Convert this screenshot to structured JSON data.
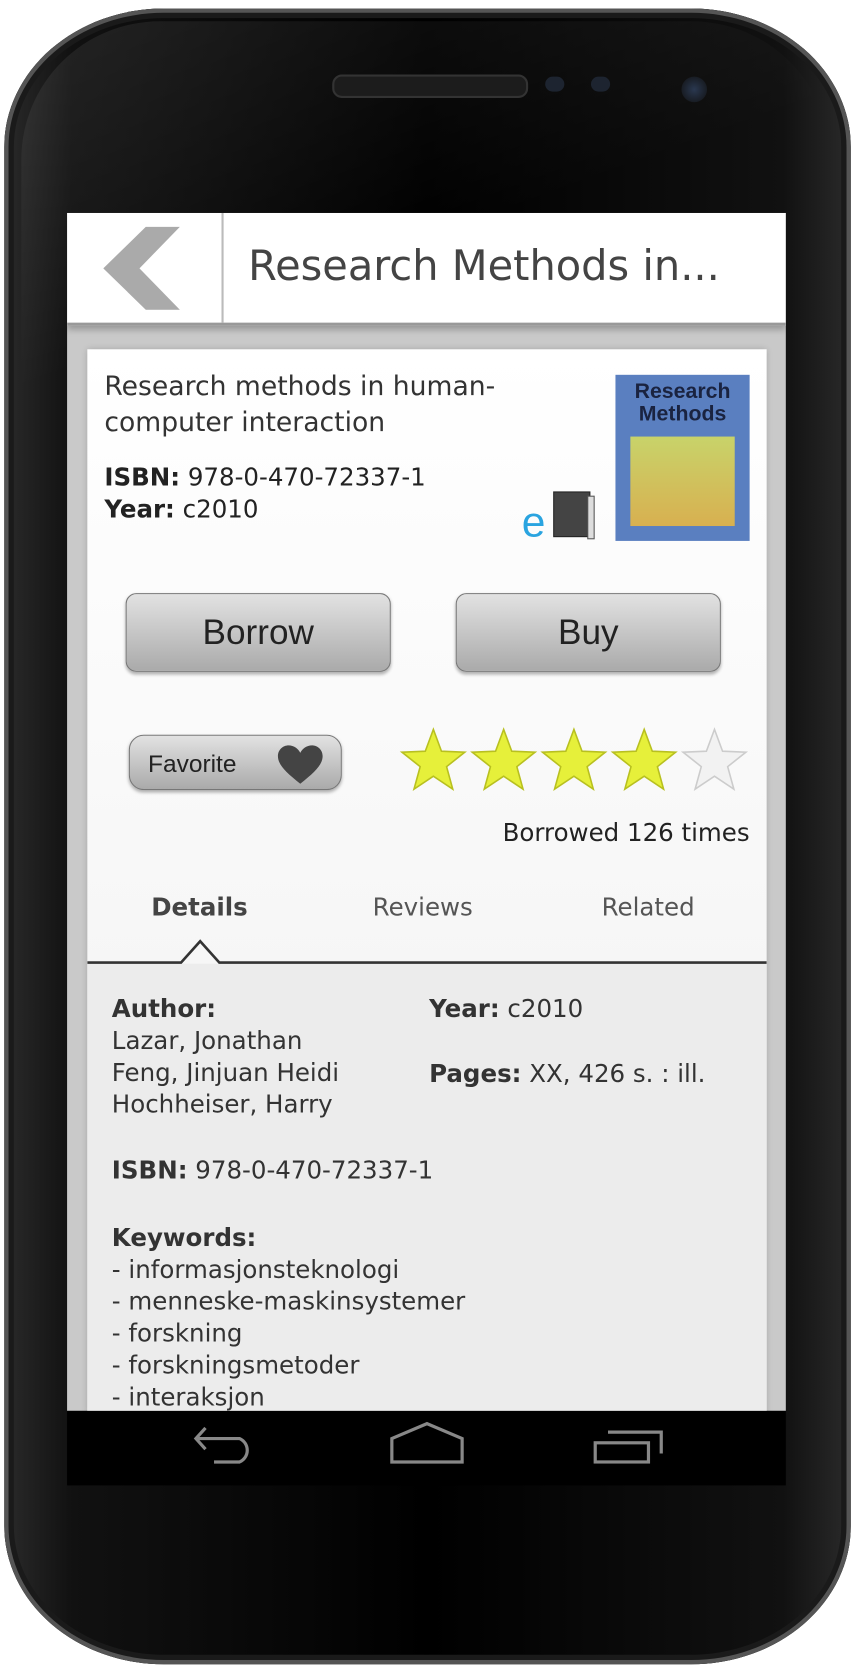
{
  "header": {
    "title": "Research Methods in...",
    "back_icon": "chevron-left-icon"
  },
  "book": {
    "title": "Research methods in human-computer interaction",
    "isbn_label": "ISBN:",
    "isbn": "978-0-470-72337-1",
    "year_label": "Year:",
    "year": "c2010",
    "ebook_icon": "ebook-icon",
    "cover_title": "Research Methods"
  },
  "actions": {
    "borrow": "Borrow",
    "buy": "Buy",
    "favorite": "Favorite",
    "favorite_icon": "heart-icon"
  },
  "rating": {
    "value": 4,
    "max": 5,
    "filled_color": "#e6f03a",
    "empty_color": "#f2f2f2"
  },
  "borrowed_text": "Borrowed 126 times",
  "tabs": [
    {
      "label": "Details",
      "active": true
    },
    {
      "label": "Reviews"
    },
    {
      "label": "Related"
    }
  ],
  "details": {
    "author_label": "Author:",
    "authors": [
      "Lazar, Jonathan",
      "Feng, Jinjuan Heidi",
      "Hochheiser, Harry"
    ],
    "year_label": "Year:",
    "year": "c2010",
    "pages_label": "Pages:",
    "pages": "XX, 426 s. : ill.",
    "isbn_label": "ISBN:",
    "isbn": "978-0-470-72337-1",
    "keywords_label": "Keywords:",
    "keywords": [
      "- informasjonsteknologi",
      "- menneske-maskinsystemer",
      "- forskning",
      "- forskningsmetoder",
      "- interaksjon"
    ]
  },
  "navbar": {
    "icons": [
      "back-icon",
      "home-icon",
      "recent-apps-icon"
    ]
  }
}
